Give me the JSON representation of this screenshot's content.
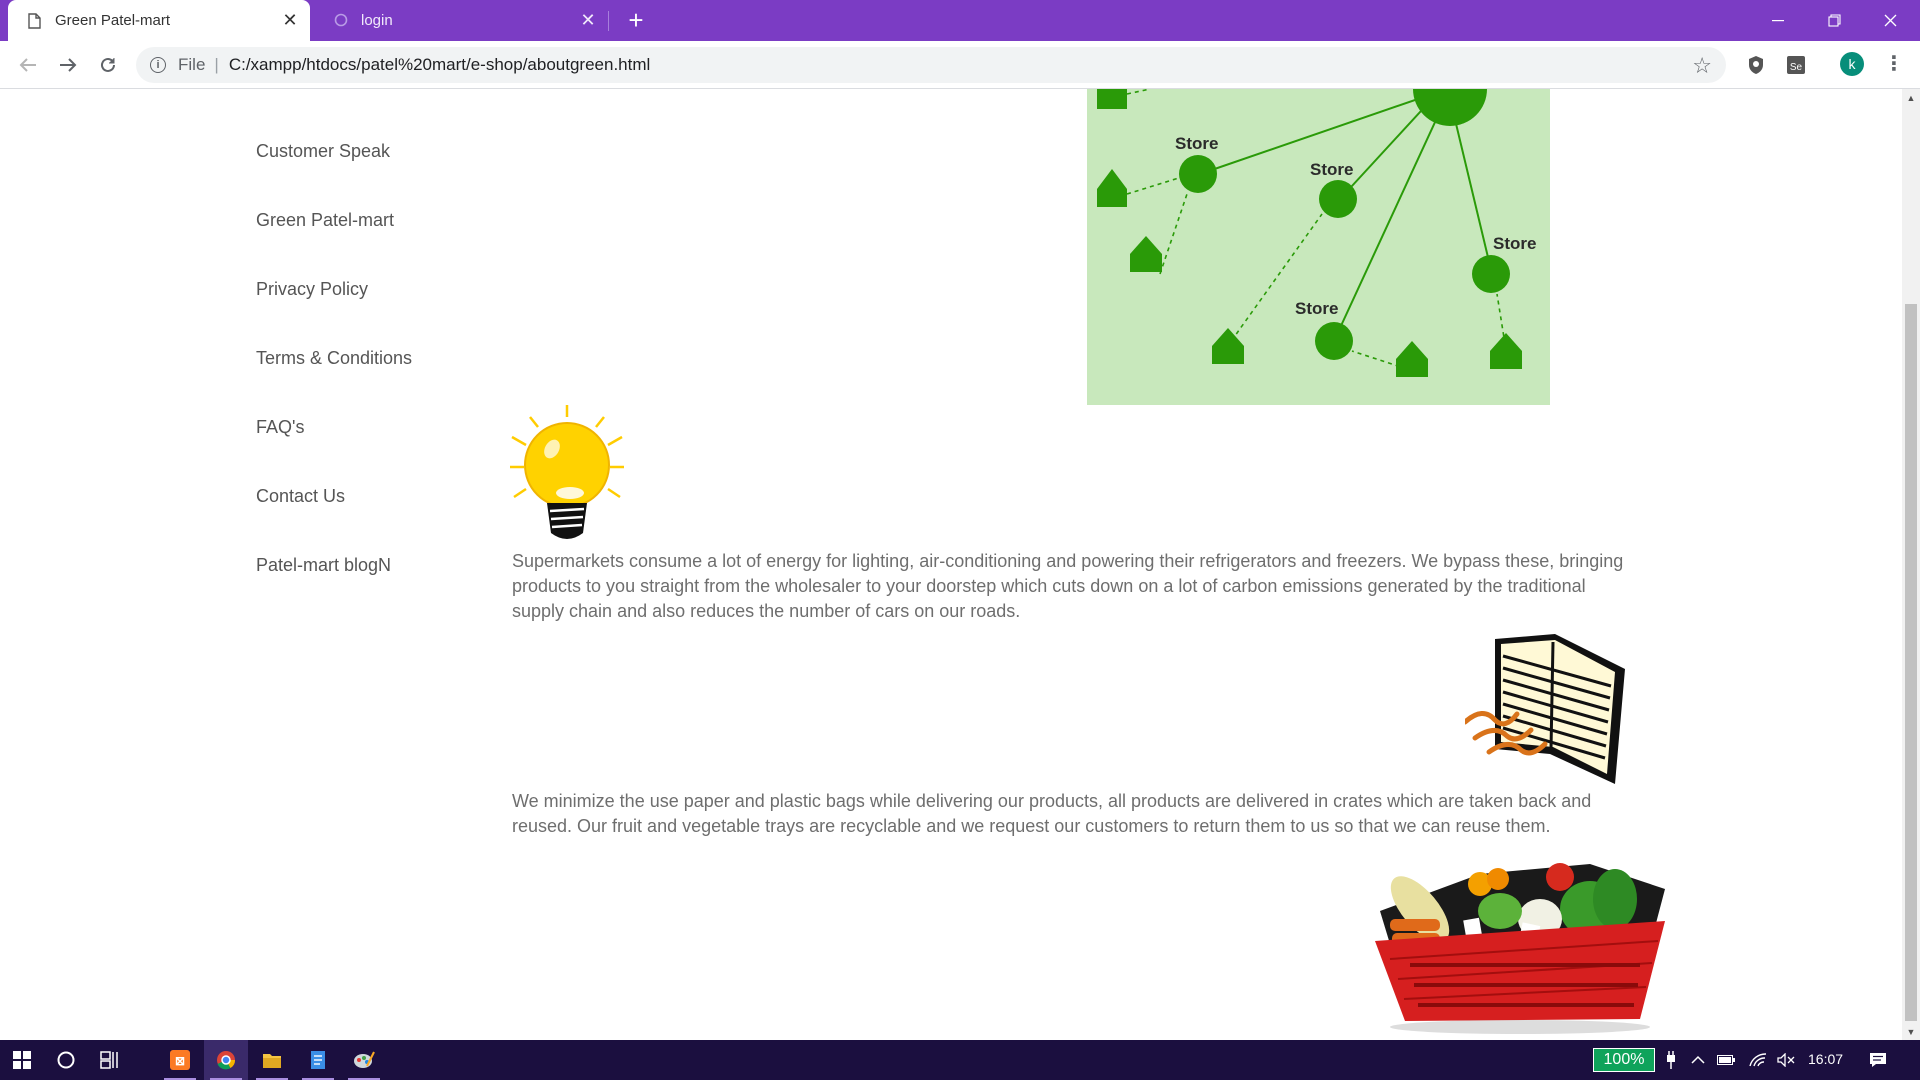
{
  "browser": {
    "tabs": [
      {
        "title": "Green Patel-mart",
        "active": true
      },
      {
        "title": "login",
        "active": false
      }
    ],
    "new_tab_label": "+",
    "address": {
      "scheme": "File",
      "url": "C:/xampp/htdocs/patel%20mart/e-shop/aboutgreen.html"
    },
    "profile_initial": "k",
    "accent_color": "#7b3cc4"
  },
  "sidebar": {
    "items": [
      {
        "label": "Customer Speak"
      },
      {
        "label": "Green Patel-mart"
      },
      {
        "label": "Privacy Policy"
      },
      {
        "label": "Terms & Conditions"
      },
      {
        "label": "FAQ's"
      },
      {
        "label": "Contact Us"
      },
      {
        "label": "Patel-mart blogN"
      }
    ]
  },
  "main": {
    "network_diagram": {
      "store_labels": [
        "Store",
        "Store",
        "Store",
        "Store"
      ],
      "background_color": "#c8e8bc",
      "node_color": "#2a9a08"
    },
    "paragraph_energy": "Supermarkets consume a lot of energy for lighting, air-conditioning and powering their refrigerators and freezers. We bypass these, bringing products to you straight from the wholesaler to your doorstep which cuts down on a lot of carbon emissions generated by the traditional supply chain and also reduces the number of cars on our roads.",
    "paragraph_packaging": "We minimize the use paper and plastic bags while delivering our products, all products are delivered in crates which are taken back and reused. Our fruit and vegetable trays are recyclable and we request our customers to return them to us so that we can reuse them."
  },
  "taskbar": {
    "battery_percent": "100%",
    "clock": "16:07",
    "color": "#1b0f3f"
  }
}
